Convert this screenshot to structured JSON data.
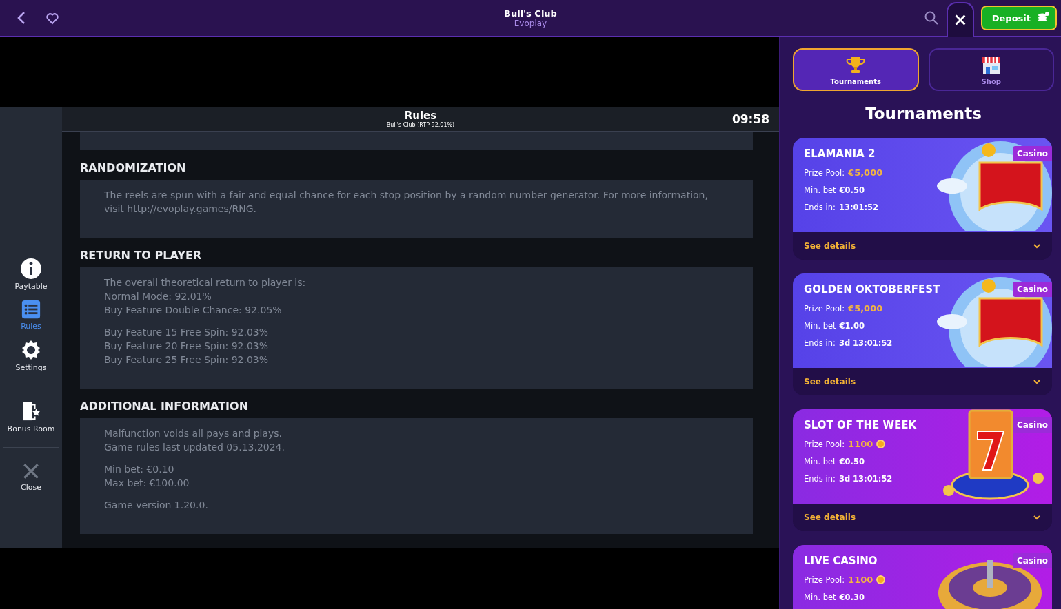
{
  "header": {
    "title": "Bull's Club",
    "subtitle": "Evoplay",
    "deposit": "Deposit"
  },
  "rules": {
    "title": "Rules",
    "subtitle": "Bull's Club (RTP 92.01%)",
    "time": "09:58",
    "sections": [
      {
        "heading": "RANDOMIZATION",
        "groups": [
          [
            "The reels are spun with a fair and equal chance for each stop position by a random number generator. For more information, visit http://evoplay.games/RNG."
          ]
        ]
      },
      {
        "heading": "RETURN TO PLAYER",
        "groups": [
          [
            "The overall theoretical return to player is:",
            "Normal Mode: 92.01%",
            "Buy Feature Double Chance: 92.05%"
          ],
          [
            "Buy Feature 15 Free Spin: 92.03%",
            "Buy Feature 20 Free Spin: 92.03%",
            "Buy Feature 25 Free Spin: 92.03%"
          ]
        ]
      },
      {
        "heading": "ADDITIONAL INFORMATION",
        "groups": [
          [
            "Malfunction voids all pays and plays.",
            "Game rules last updated 05.13.2024."
          ],
          [
            "Min bet: €0.10",
            "Max bet: €100.00"
          ],
          [
            "Game version 1.20.0."
          ]
        ]
      }
    ]
  },
  "sidebar": [
    {
      "kind": "info",
      "label": "Paytable",
      "selected": false
    },
    {
      "kind": "list",
      "label": "Rules",
      "selected": true
    },
    {
      "kind": "gear",
      "label": "Settings",
      "selected": false
    },
    {
      "kind": "door",
      "label": "Bonus Room",
      "selected": false
    },
    {
      "kind": "close",
      "label": "Close",
      "selected": false
    }
  ],
  "tabs": [
    {
      "kind": "trophy",
      "label": "Tournaments",
      "selected": true
    },
    {
      "kind": "shop",
      "label": "Shop",
      "selected": false
    }
  ],
  "panel_title": "Tournaments",
  "tournaments": [
    {
      "kind": "carpet",
      "title": "ELAMANIA 2",
      "badge": "Casino",
      "prize_label": "Prize Pool:",
      "prize": "€5,000",
      "coin": false,
      "bet_label": "Min. bet",
      "bet": "€0.50",
      "ends_label": "Ends in:",
      "ends": "13:01:52",
      "details": "See details"
    },
    {
      "kind": "carpet",
      "title": "GOLDEN OKTOBERFEST",
      "badge": "Casino",
      "prize_label": "Prize Pool:",
      "prize": "€5,000",
      "coin": false,
      "bet_label": "Min. bet",
      "bet": "€1.00",
      "ends_label": "Ends in:",
      "ends": "3d 13:01:52",
      "details": "See details"
    },
    {
      "kind": "slot",
      "title": "SLOT OF THE WEEK",
      "badge": "Casino",
      "prize_label": "Prize Pool:",
      "prize": "1100",
      "coin": true,
      "bet_label": "Min. bet",
      "bet": "€0.50",
      "ends_label": "Ends in:",
      "ends": "3d 13:01:52",
      "details": "See details"
    },
    {
      "kind": "roulette",
      "title": "LIVE CASINO",
      "badge": "Casino",
      "prize_label": "Prize Pool:",
      "prize": "1100",
      "coin": true,
      "bet_label": "Min. bet",
      "bet": "€0.30"
    }
  ]
}
